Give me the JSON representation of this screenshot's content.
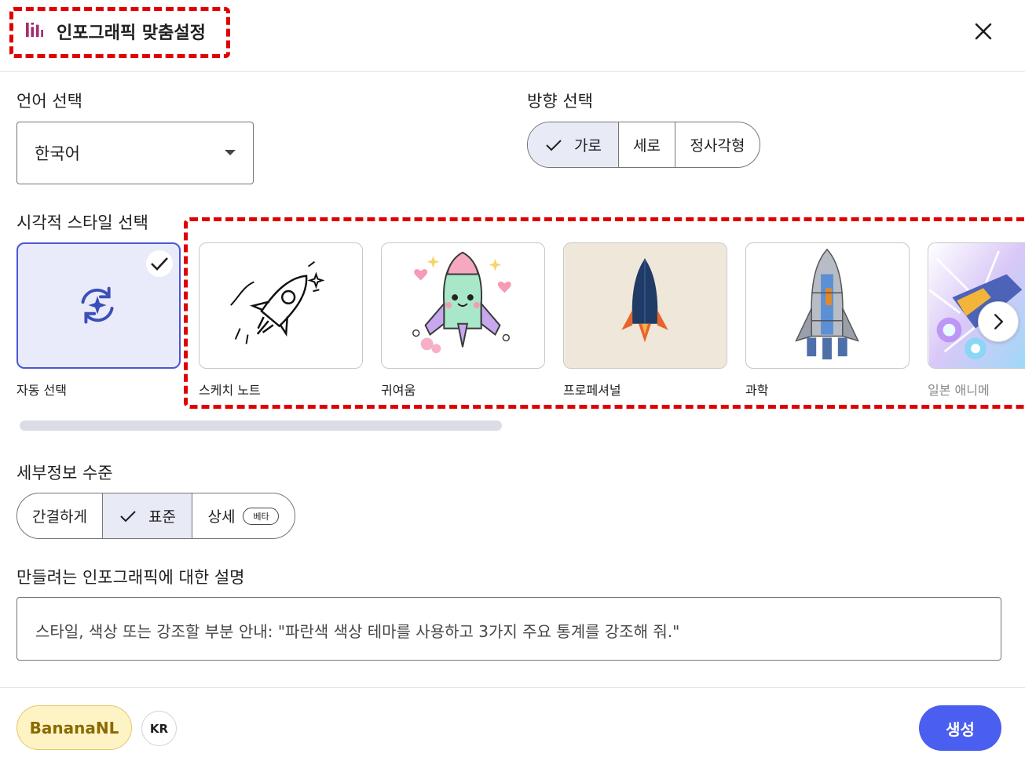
{
  "header": {
    "title": "인포그래픽 맞춤설정",
    "icon": "chart-bars-icon",
    "close_icon": "close-icon",
    "accent": "#a12f6e"
  },
  "language": {
    "label": "언어 선택",
    "value": "한국어"
  },
  "orientation": {
    "label": "방향 선택",
    "options": [
      "가로",
      "세로",
      "정사각형"
    ],
    "selected": "가로"
  },
  "style": {
    "label": "시각적 스타일 선택",
    "options": [
      "자동 선택",
      "스케치 노트",
      "귀여움",
      "프로페셔널",
      "과학",
      "일본 애니메이션"
    ],
    "visible_last_label": "일본 애니메",
    "selected": "자동 선택",
    "next_icon": "chevron-right-icon"
  },
  "detail": {
    "label": "세부정보 수준",
    "options": [
      "간결하게",
      "표준",
      "상세"
    ],
    "selected": "표준",
    "beta_badge": "베타"
  },
  "description": {
    "label": "만들려는 인포그래픽에 대한 설명",
    "placeholder": "스타일, 색상 또는 강조할 부분 안내: \"파란색 색상 테마를 사용하고 3가지 주요 통계를 강조해 줘.\""
  },
  "footer": {
    "brand": "BananaNL",
    "locale": "KR",
    "generate": "생성"
  },
  "colors": {
    "primary": "#4a5ef0",
    "selected_bg": "#e8eaf6",
    "highlight_frame": "#e00000"
  }
}
